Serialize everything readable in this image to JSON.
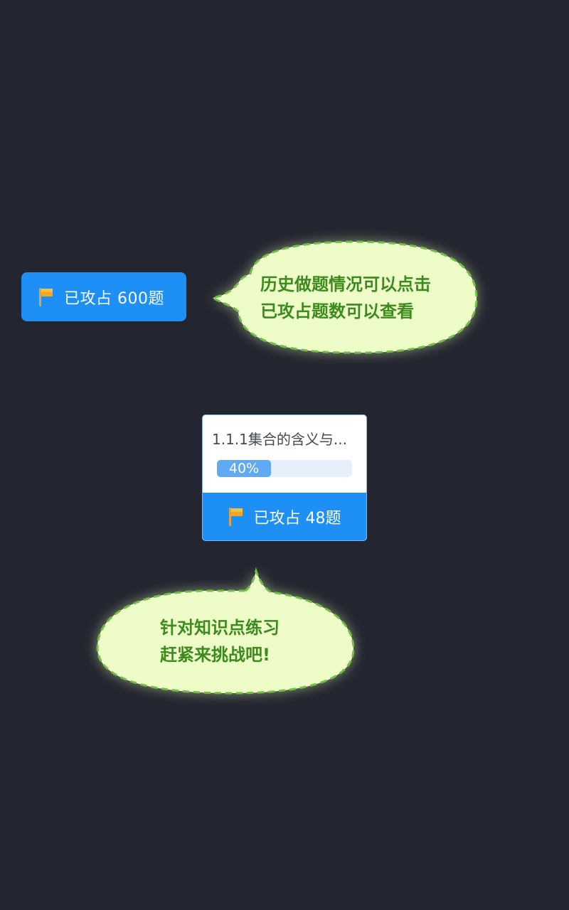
{
  "history_button": {
    "icon": "flag-icon",
    "label": "已攻占 600题"
  },
  "tip_history": {
    "lines": [
      "历史做题情况可以点击",
      "已攻占题数可以查看"
    ]
  },
  "knowledge_card": {
    "title": "1.1.1集合的含义与...",
    "progress": 0.4,
    "progress_label": "40%",
    "footer_icon": "flag-icon",
    "footer_label": "已攻占 48题"
  },
  "tip_practice": {
    "lines": [
      "针对知识点练习",
      "赶紧来挑战吧!"
    ]
  },
  "colors": {
    "background": "#232530",
    "primary_blue": "#1e90f5",
    "progress_fill": "#5fa9f5",
    "progress_track": "#e6f0fc",
    "bubble_fill": "#eefcc8",
    "bubble_border": "#6fbf45",
    "bubble_text": "#3d8b1e",
    "flag": "#f5a623"
  }
}
